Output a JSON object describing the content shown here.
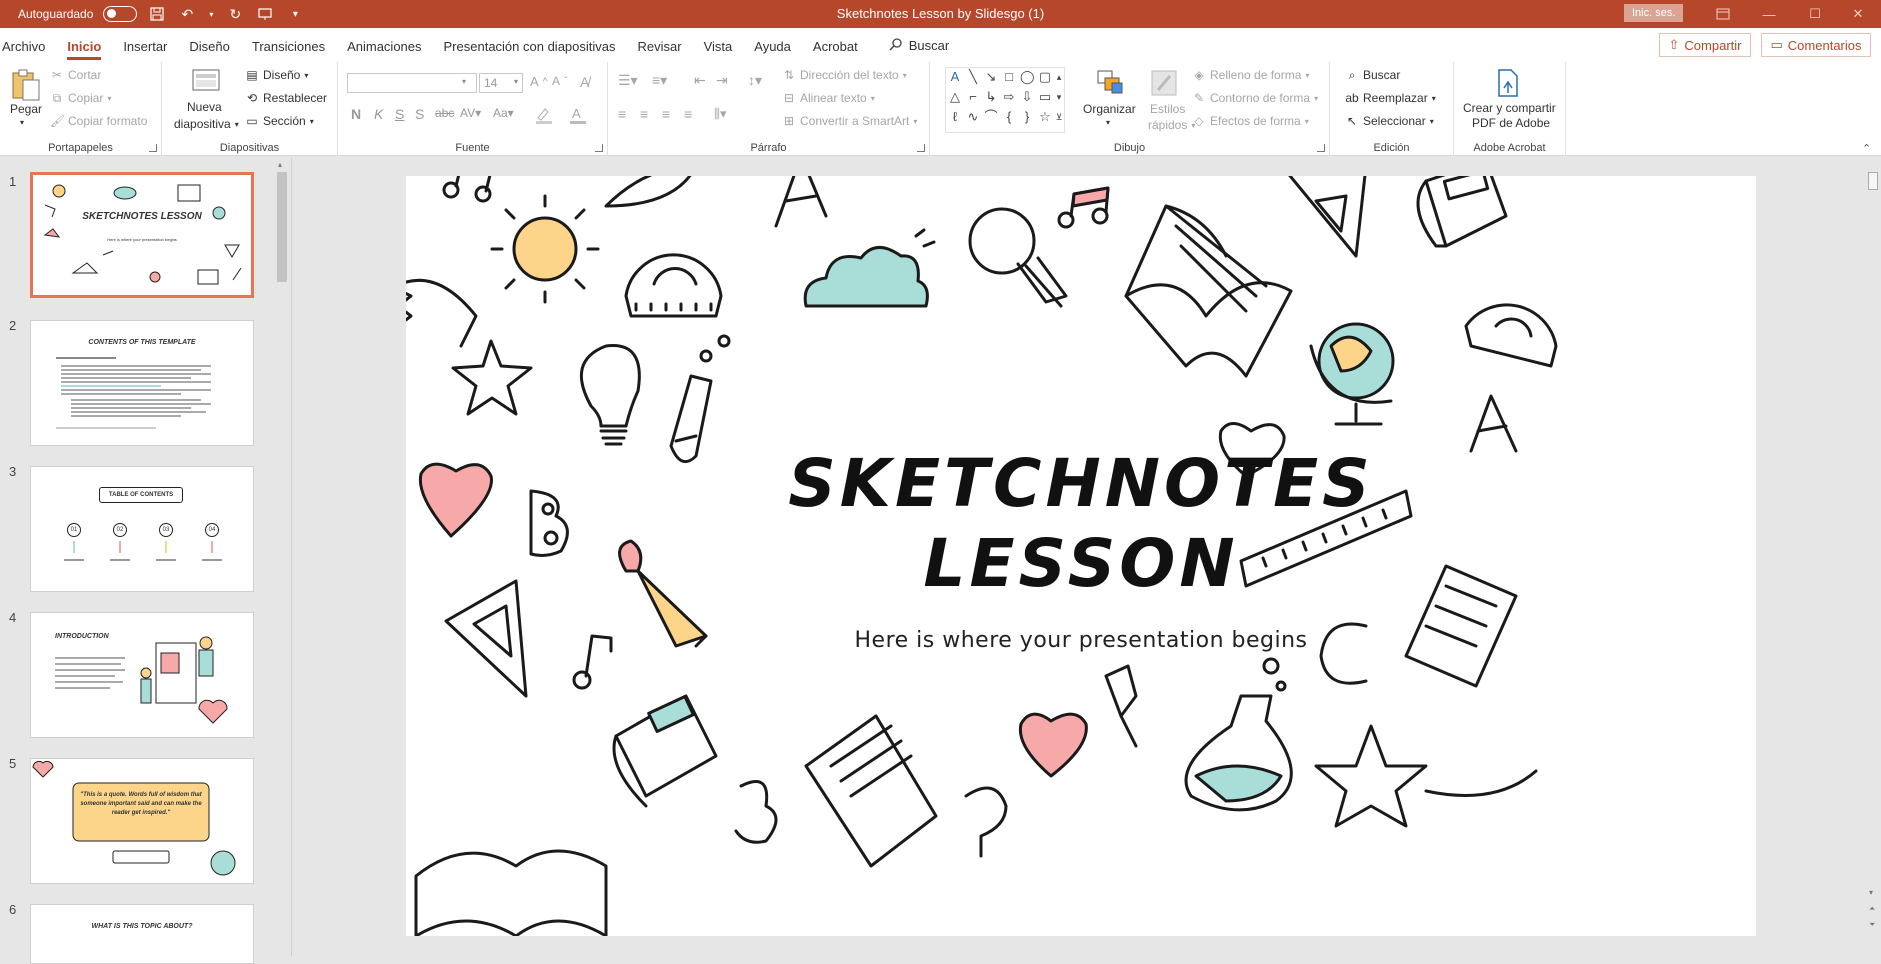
{
  "titlebar": {
    "autosave_label": "Autoguardado",
    "doc_title": "Sketchnotes Lesson by Slidesgo (1)",
    "signin": "Inic. ses."
  },
  "tabs": [
    "Archivo",
    "Inicio",
    "Insertar",
    "Diseño",
    "Transiciones",
    "Animaciones",
    "Presentación con diapositivas",
    "Revisar",
    "Vista",
    "Ayuda",
    "Acrobat"
  ],
  "active_tab": "Inicio",
  "search_label": "Buscar",
  "share_label": "Compartir",
  "comments_label": "Comentarios",
  "ribbon": {
    "portapapeles": {
      "label": "Portapapeles",
      "pegar": "Pegar",
      "cortar": "Cortar",
      "copiar": "Copiar",
      "copiar_formato": "Copiar formato"
    },
    "diapositivas": {
      "label": "Diapositivas",
      "nueva": "Nueva",
      "diapositiva": "diapositiva",
      "diseno": "Diseño",
      "restablecer": "Restablecer",
      "seccion": "Sección"
    },
    "fuente": {
      "label": "Fuente",
      "font_name": "",
      "font_size": "14"
    },
    "parrafo": {
      "label": "Párrafo",
      "direccion": "Dirección del texto",
      "alinear": "Alinear texto",
      "convertir": "Convertir a SmartArt"
    },
    "dibujo": {
      "label": "Dibujo",
      "organizar": "Organizar",
      "estilos1": "Estilos",
      "estilos2": "rápidos",
      "relleno": "Relleno de forma",
      "contorno": "Contorno de forma",
      "efectos": "Efectos de forma"
    },
    "edicion": {
      "label": "Edición",
      "buscar": "Buscar",
      "reemplazar": "Reemplazar",
      "seleccionar": "Seleccionar"
    },
    "acrobat": {
      "label": "Adobe Acrobat",
      "crear1": "Crear y compartir",
      "crear2": "PDF de Adobe"
    }
  },
  "thumbnails": [
    {
      "num": "1",
      "title": "SKETCHNOTES LESSON",
      "sub": "Here is where your presentation begins"
    },
    {
      "num": "2",
      "title": "CONTENTS OF THIS TEMPLATE"
    },
    {
      "num": "3",
      "title": "TABLE OF CONTENTS",
      "items": [
        "01",
        "02",
        "03",
        "04"
      ]
    },
    {
      "num": "4",
      "title": "INTRODUCTION"
    },
    {
      "num": "5",
      "title": "\"This is a quote. Words full of wisdom that someone important said and can make the reader get inspired.\""
    },
    {
      "num": "6",
      "title": "WHAT IS THIS TOPIC ABOUT?"
    }
  ],
  "slide": {
    "title_line1": "SKETCHNOTES",
    "title_line2": "LESSON",
    "subtitle": "Here is where your presentation begins",
    "colors": {
      "yellow": "#fdd58a",
      "teal": "#a8ddd8",
      "pink": "#f7a8a8",
      "ink": "#1a1a1a"
    }
  },
  "colors": {
    "accent": "#b7472a"
  }
}
